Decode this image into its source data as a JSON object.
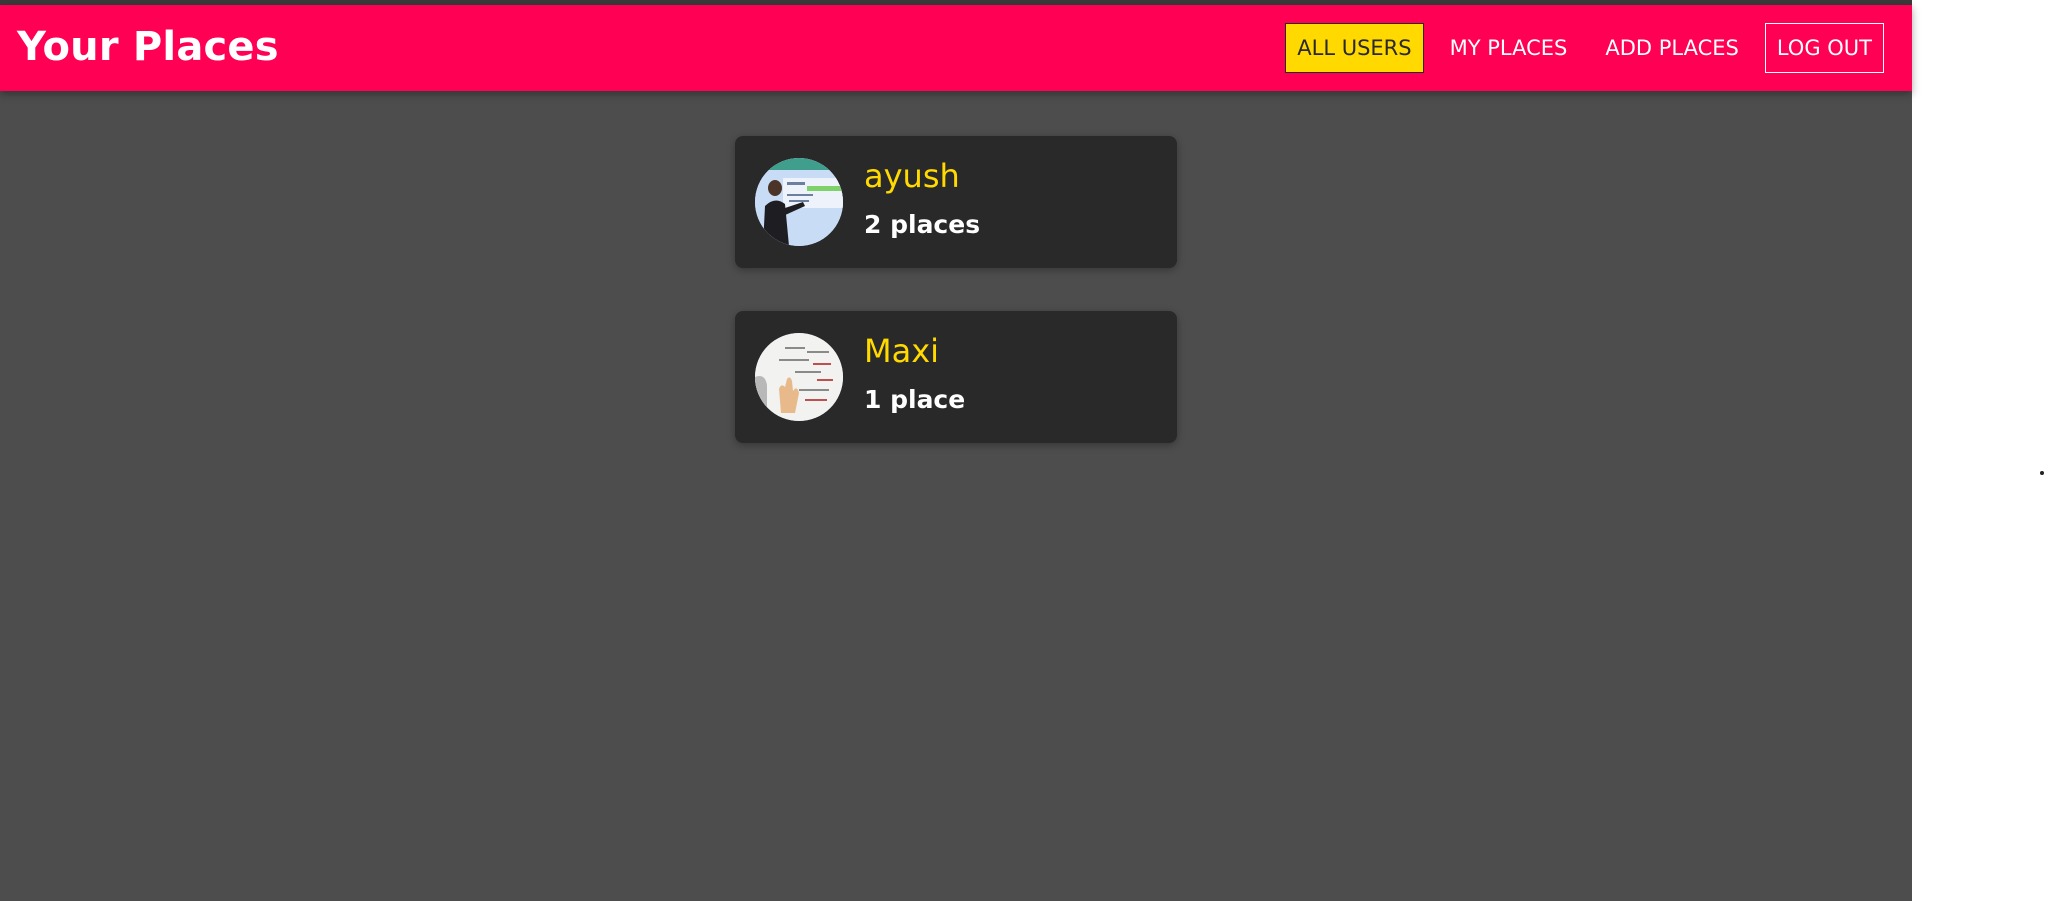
{
  "header": {
    "title": "Your Places",
    "brand_color": "#ff0055",
    "nav": [
      {
        "label": "ALL USERS",
        "state": "active"
      },
      {
        "label": "MY PLACES",
        "state": "default"
      },
      {
        "label": "ADD PLACES",
        "state": "default"
      },
      {
        "label": "LOG OUT",
        "state": "outlined"
      }
    ]
  },
  "users": [
    {
      "name": "ayush",
      "places": "2 places",
      "avatar": "user-photo-presenter-at-whiteboard"
    },
    {
      "name": "Maxi",
      "places": "1 place",
      "avatar": "user-photo-hand-on-whiteboard"
    }
  ],
  "colors": {
    "background": "#4d4d4d",
    "card": "#292929",
    "accent": "#ffd900",
    "text": "#ffffff"
  }
}
